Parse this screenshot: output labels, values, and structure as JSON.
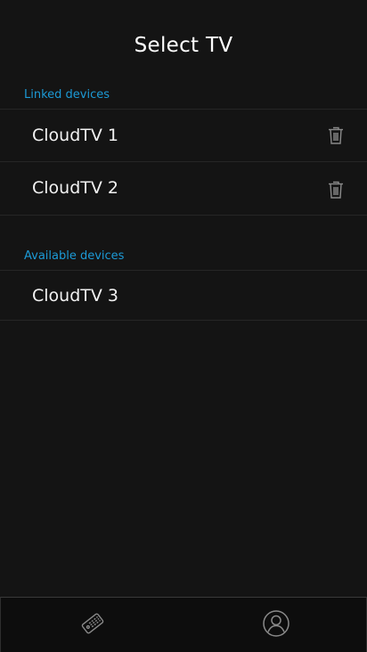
{
  "header": {
    "title": "Select TV"
  },
  "linked": {
    "label": "Linked devices",
    "devices": [
      {
        "name": "CloudTV 1"
      },
      {
        "name": "CloudTV 2"
      }
    ]
  },
  "available": {
    "label": "Available devices",
    "devices": [
      {
        "name": "CloudTV 3"
      }
    ]
  },
  "tabbar": {
    "tabs": [
      {
        "icon": "remote-icon"
      },
      {
        "icon": "profile-icon"
      }
    ]
  },
  "colors": {
    "background": "#141414",
    "accent": "#1c9ad6",
    "text": "#f2f2f2",
    "icon": "#8a8a8a"
  }
}
